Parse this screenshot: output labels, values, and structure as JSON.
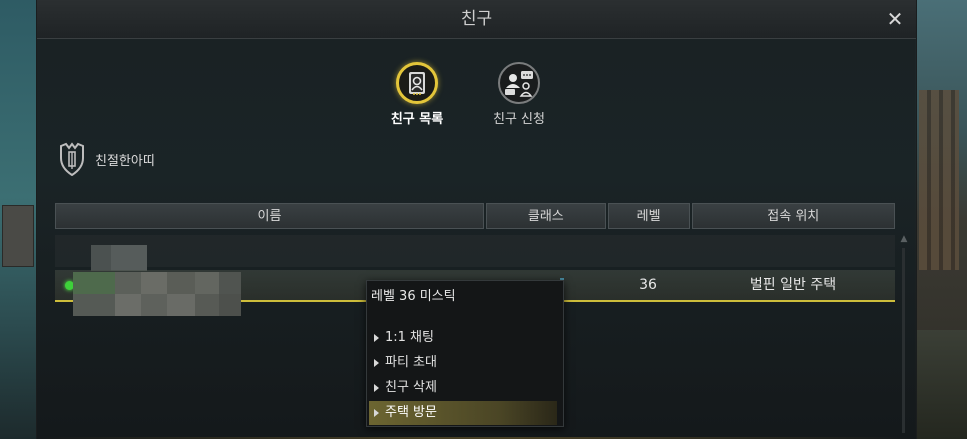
{
  "window": {
    "title": "친구",
    "close_symbol": "✕"
  },
  "tabs": [
    {
      "label": "친구 목록",
      "icon": "friend-list-icon",
      "active": true
    },
    {
      "label": "친구 신청",
      "icon": "friend-request-icon",
      "active": false
    }
  ],
  "guild": {
    "name": "친절한아띠",
    "icon": "guild-shield-icon"
  },
  "table": {
    "headers": {
      "name": "이름",
      "class": "클래스",
      "level": "레벨",
      "location": "접속 위치"
    },
    "group_label": "",
    "rows": [
      {
        "status": "online",
        "name": "",
        "class": "",
        "level": "36",
        "location": "벌핀 일반 주택"
      }
    ]
  },
  "context_menu": {
    "header": "레벨 36 미스틱",
    "items": [
      {
        "label": "1:1 채팅",
        "active": false
      },
      {
        "label": "파티 초대",
        "active": false
      },
      {
        "label": "친구 삭제",
        "active": false
      },
      {
        "label": "주택 방문",
        "active": true
      }
    ]
  },
  "colors": {
    "accent_gold": "#e3c53a",
    "online_green": "#3ed23a",
    "row_underline": "#cdbd3b"
  }
}
